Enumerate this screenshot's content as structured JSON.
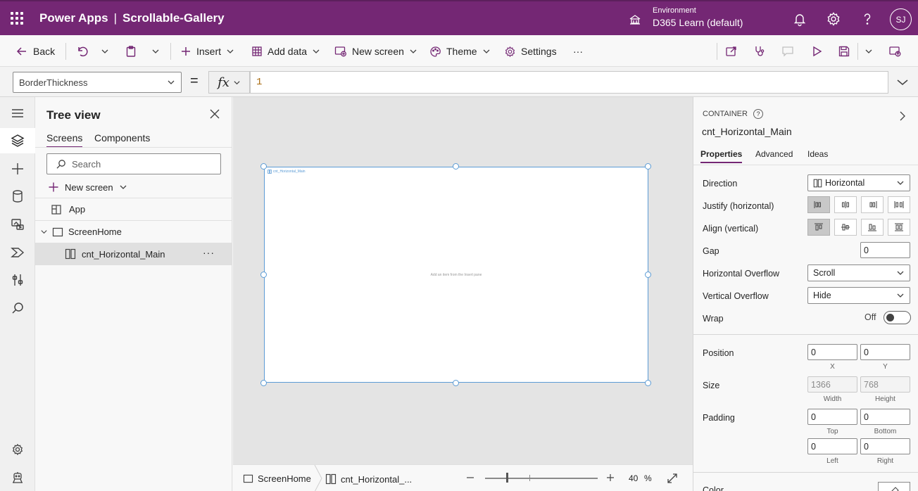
{
  "header": {
    "app_name": "Power Apps",
    "separator": "|",
    "doc_name": "Scrollable-Gallery",
    "env_label": "Environment",
    "env_value": "D365 Learn (default)",
    "user_initials": "SJ"
  },
  "toolbar": {
    "back": "Back",
    "insert": "Insert",
    "add_data": "Add data",
    "new_screen": "New screen",
    "theme": "Theme",
    "settings": "Settings",
    "more": "···"
  },
  "formula": {
    "property": "BorderThickness",
    "equals": "=",
    "fx": "fx",
    "value": "1"
  },
  "tree": {
    "title": "Tree view",
    "tabs": [
      "Screens",
      "Components"
    ],
    "search_placeholder": "Search",
    "new_screen": "New screen",
    "items": [
      {
        "label": "App"
      },
      {
        "label": "ScreenHome"
      },
      {
        "label": "cnt_Horizontal_Main",
        "more": "···"
      }
    ]
  },
  "canvas": {
    "container_label": "cnt_Horizontal_Main",
    "hint": "Add an item from the Insert pane"
  },
  "statusbar": {
    "crumb1": "ScreenHome",
    "crumb2": "cnt_Horizontal_...",
    "zoom_value": "40",
    "zoom_unit": "%"
  },
  "props": {
    "kind": "CONTAINER",
    "help": "?",
    "name": "cnt_Horizontal_Main",
    "tabs": [
      "Properties",
      "Advanced",
      "Ideas"
    ],
    "direction_label": "Direction",
    "direction_value": "Horizontal",
    "justify_label": "Justify (horizontal)",
    "align_label": "Align (vertical)",
    "gap_label": "Gap",
    "gap_value": "0",
    "hoverflow_label": "Horizontal Overflow",
    "hoverflow_value": "Scroll",
    "voverflow_label": "Vertical Overflow",
    "voverflow_value": "Hide",
    "wrap_label": "Wrap",
    "wrap_value": "Off",
    "position_label": "Position",
    "pos_x": "0",
    "pos_y": "0",
    "x_label": "X",
    "y_label": "Y",
    "size_label": "Size",
    "width": "1366",
    "height": "768",
    "width_label": "Width",
    "height_label": "Height",
    "padding_label": "Padding",
    "pad_top": "0",
    "pad_bottom": "0",
    "pad_left": "0",
    "pad_right": "0",
    "top_label": "Top",
    "bottom_label": "Bottom",
    "left_label": "Left",
    "right_label": "Right",
    "color_label": "Color"
  },
  "colors": {
    "brand": "#742774",
    "selection": "#5b9bd5",
    "formula_value": "#a86a0e"
  }
}
